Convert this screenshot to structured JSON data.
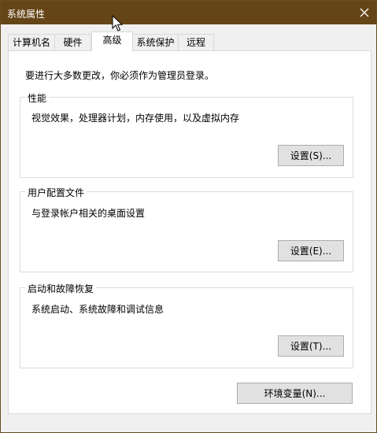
{
  "window": {
    "title": "系统属性",
    "close_icon": "close-icon"
  },
  "tabs": [
    {
      "label": "计算机名",
      "active": false
    },
    {
      "label": "硬件",
      "active": false
    },
    {
      "label": "高级",
      "active": true
    },
    {
      "label": "系统保护",
      "active": false
    },
    {
      "label": "远程",
      "active": false
    }
  ],
  "advanced": {
    "admin_note": "要进行大多数更改，你必须作为管理员登录。",
    "performance": {
      "label": "性能",
      "description": "视觉效果，处理器计划，内存使用，以及虚拟内存",
      "button": "设置(S)..."
    },
    "user_profiles": {
      "label": "用户配置文件",
      "description": "与登录帐户相关的桌面设置",
      "button": "设置(E)..."
    },
    "startup_recovery": {
      "label": "启动和故障恢复",
      "description": "系统启动、系统故障和调试信息",
      "button": "设置(T)..."
    },
    "env_button": "环境变量(N)..."
  },
  "colors": {
    "titlebar": "#654517",
    "panel": "#ffffff",
    "button": "#e1e1e1"
  }
}
